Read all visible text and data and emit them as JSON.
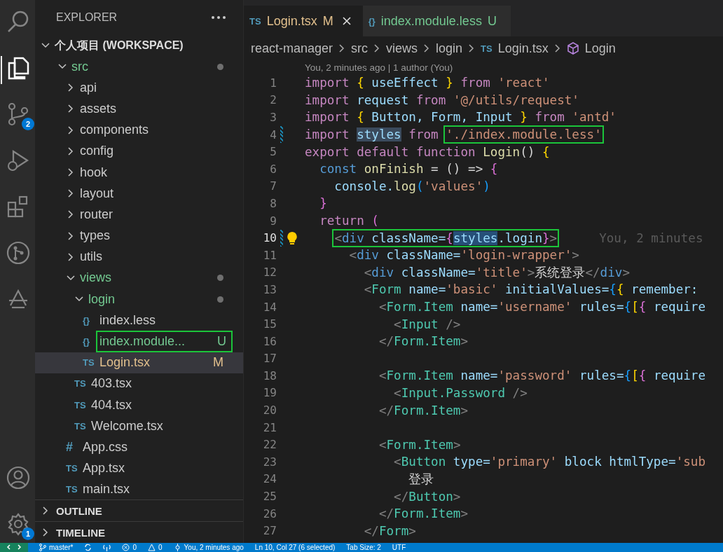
{
  "activity_bar": {
    "top": [
      {
        "kind": "search",
        "selected": false
      },
      {
        "kind": "explorer",
        "selected": true
      },
      {
        "kind": "source-control",
        "selected": false,
        "badge": "2"
      },
      {
        "kind": "run",
        "selected": false
      },
      {
        "kind": "extensions",
        "selected": false
      },
      {
        "kind": "git-graph",
        "selected": false
      },
      {
        "kind": "timeline",
        "selected": false
      }
    ],
    "bottom": [
      {
        "kind": "account"
      },
      {
        "kind": "settings",
        "badge": "1"
      }
    ]
  },
  "sidebar": {
    "title": "EXPLORER",
    "workspace": "个人项目 (WORKSPACE)",
    "tree": [
      {
        "name": "src",
        "kind": "folder",
        "expanded": true,
        "dot": true,
        "color": "#73c991",
        "children": [
          {
            "name": "api",
            "kind": "folder",
            "expanded": false,
            "color": "#cccccc"
          },
          {
            "name": "assets",
            "kind": "folder",
            "expanded": false,
            "color": "#cccccc"
          },
          {
            "name": "components",
            "kind": "folder",
            "expanded": false,
            "color": "#cccccc"
          },
          {
            "name": "config",
            "kind": "folder",
            "expanded": false,
            "color": "#cccccc"
          },
          {
            "name": "hook",
            "kind": "folder",
            "expanded": false,
            "color": "#cccccc"
          },
          {
            "name": "layout",
            "kind": "folder",
            "expanded": false,
            "color": "#cccccc"
          },
          {
            "name": "router",
            "kind": "folder",
            "expanded": false,
            "color": "#cccccc"
          },
          {
            "name": "types",
            "kind": "folder",
            "expanded": false,
            "color": "#cccccc"
          },
          {
            "name": "utils",
            "kind": "folder",
            "expanded": false,
            "color": "#cccccc"
          },
          {
            "name": "views",
            "kind": "folder",
            "expanded": true,
            "dot": true,
            "color": "#73c991",
            "children": [
              {
                "name": "login",
                "kind": "folder",
                "expanded": true,
                "dot": true,
                "color": "#73c991",
                "children": [
                  {
                    "name": "index.less",
                    "kind": "file",
                    "icon": "{}",
                    "selected": false,
                    "color": "#cccccc"
                  },
                  {
                    "name": "index.module...",
                    "kind": "file",
                    "icon": "{}",
                    "decoration": "U",
                    "highlighted": true,
                    "selected": false,
                    "color": "#73c991"
                  },
                  {
                    "name": "Login.tsx",
                    "kind": "file",
                    "icon": "TS",
                    "decoration": "M",
                    "selected": true,
                    "color": "#e2c08d"
                  }
                ]
              },
              {
                "name": "403.tsx",
                "kind": "file",
                "icon": "TS",
                "selected": false,
                "color": "#cccccc"
              },
              {
                "name": "404.tsx",
                "kind": "file",
                "icon": "TS",
                "selected": false,
                "color": "#cccccc"
              },
              {
                "name": "Welcome.tsx",
                "kind": "file",
                "icon": "TS",
                "selected": false,
                "color": "#cccccc"
              }
            ]
          },
          {
            "name": "App.css",
            "kind": "file",
            "icon": "#",
            "selected": false,
            "color": "#cccccc"
          },
          {
            "name": "App.tsx",
            "kind": "file",
            "icon": "TS",
            "selected": false,
            "color": "#cccccc"
          },
          {
            "name": "main.tsx",
            "kind": "file",
            "icon": "TS",
            "selected": false,
            "color": "#cccccc"
          }
        ]
      }
    ],
    "sections": [
      {
        "title": "OUTLINE",
        "expanded": false
      },
      {
        "title": "TIMELINE",
        "expanded": false
      }
    ]
  },
  "tabs": [
    {
      "icon": "TS",
      "label": "Login.tsx",
      "decoration": "M",
      "selected": true,
      "color": "#e2c08d"
    },
    {
      "icon": "{}",
      "label": "index.module.less",
      "decoration": "U",
      "selected": false,
      "color": "#73c991"
    }
  ],
  "breadcrumb": [
    {
      "label": "react-manager"
    },
    {
      "label": "src"
    },
    {
      "label": "views"
    },
    {
      "label": "login"
    },
    {
      "label": "Login.tsx",
      "icon": "TS"
    },
    {
      "label": "Login",
      "kind": "symbol"
    }
  ],
  "codelens": "You, 2 minutes ago | 1 author (You)",
  "code": [
    {
      "number": "1",
      "tokens": [
        {
          "t": "import ",
          "kind": "kw"
        },
        {
          "t": "{ ",
          "kind": "br"
        },
        {
          "t": "useEffect ",
          "kind": "var"
        },
        {
          "t": "} ",
          "kind": "br"
        },
        {
          "t": "from ",
          "kind": "kw"
        },
        {
          "t": "'react'",
          "kind": "str"
        }
      ]
    },
    {
      "number": "2",
      "tokens": [
        {
          "t": "import ",
          "kind": "kw"
        },
        {
          "t": "request ",
          "kind": "var"
        },
        {
          "t": "from ",
          "kind": "kw"
        },
        {
          "t": "'@/utils/request'",
          "kind": "str"
        }
      ]
    },
    {
      "number": "3",
      "tokens": [
        {
          "t": "import ",
          "kind": "kw"
        },
        {
          "t": "{ ",
          "kind": "br"
        },
        {
          "t": "Button, Form, Input ",
          "kind": "var"
        },
        {
          "t": "} ",
          "kind": "br"
        },
        {
          "t": "from ",
          "kind": "kw"
        },
        {
          "t": "'antd'",
          "kind": "str"
        }
      ]
    },
    {
      "number": "4",
      "modified": true,
      "tokens": [
        {
          "t": "import ",
          "kind": "kw"
        },
        {
          "t": "styles",
          "kind": "var",
          "selected": true
        },
        {
          "t": " from ",
          "kind": "kw"
        },
        {
          "kind": "frame",
          "tokens": [
            {
              "t": "'./index.module.less'",
              "kind": "str"
            }
          ]
        }
      ]
    },
    {
      "number": "5",
      "tokens": [
        {
          "t": "export default function ",
          "kind": "kw"
        },
        {
          "t": "Login",
          "kind": "fn"
        },
        {
          "t": "() ",
          "kind": "p"
        },
        {
          "t": "{",
          "kind": "br"
        }
      ]
    },
    {
      "number": "6",
      "tokens": [
        {
          "t": "  const",
          "kind": "kw2"
        },
        {
          "t": " onFinish ",
          "kind": "fn"
        },
        {
          "t": "= () => ",
          "kind": "p"
        },
        {
          "t": "{",
          "kind": "br2"
        }
      ]
    },
    {
      "number": "7",
      "tokens": [
        {
          "t": "    console.",
          "kind": "var"
        },
        {
          "t": "log",
          "kind": "fn"
        },
        {
          "t": "(",
          "kind": "br3"
        },
        {
          "t": "'values'",
          "kind": "str"
        },
        {
          "t": ")",
          "kind": "br3"
        }
      ]
    },
    {
      "number": "8",
      "tokens": [
        {
          "t": "  }",
          "kind": "br2"
        }
      ]
    },
    {
      "number": "9",
      "tokens": [
        {
          "t": "  return ",
          "kind": "kw"
        },
        {
          "t": "(",
          "kind": "br2"
        }
      ]
    },
    {
      "number": "10",
      "current": true,
      "modified": true,
      "lightbulb": true,
      "blame": "You, 2 minutes",
      "tokens": [
        {
          "kind": "frame",
          "tokens": [
            {
              "t": "    <",
              "kind": "ang"
            },
            {
              "t": "div",
              "kind": "tag"
            },
            {
              "t": " className=",
              "kind": "var"
            },
            {
              "t": "{",
              "kind": "br2"
            },
            {
              "t": "styles",
              "kind": "var",
              "selected": true
            },
            {
              "t": ".login",
              "kind": "var"
            },
            {
              "t": "}",
              "kind": "br2"
            },
            {
              "t": ">",
              "kind": "ang"
            }
          ]
        }
      ]
    },
    {
      "number": "11",
      "tokens": [
        {
          "t": "      <",
          "kind": "ang"
        },
        {
          "t": "div",
          "kind": "tag"
        },
        {
          "t": " className=",
          "kind": "var"
        },
        {
          "t": "'login-wrapper'",
          "kind": "str"
        },
        {
          "t": ">",
          "kind": "ang"
        }
      ]
    },
    {
      "number": "12",
      "tokens": [
        {
          "t": "        <",
          "kind": "ang"
        },
        {
          "t": "div",
          "kind": "tag"
        },
        {
          "t": " className=",
          "kind": "var"
        },
        {
          "t": "'title'",
          "kind": "str"
        },
        {
          "t": ">",
          "kind": "ang"
        },
        {
          "t": "系统登录",
          "kind": "p"
        },
        {
          "t": "</",
          "kind": "ang"
        },
        {
          "t": "div",
          "kind": "tag"
        },
        {
          "t": ">",
          "kind": "ang"
        }
      ]
    },
    {
      "number": "13",
      "tokens": [
        {
          "t": "        <",
          "kind": "ang"
        },
        {
          "t": "Form",
          "kind": "comp"
        },
        {
          "t": " name=",
          "kind": "var"
        },
        {
          "t": "'basic'",
          "kind": "str"
        },
        {
          "t": " initialValues=",
          "kind": "var"
        },
        {
          "t": "{",
          "kind": "br3"
        },
        {
          "t": "{",
          "kind": "br"
        },
        {
          "t": " remember:",
          "kind": "var"
        }
      ]
    },
    {
      "number": "14",
      "tokens": [
        {
          "t": "          <",
          "kind": "ang"
        },
        {
          "t": "Form.Item",
          "kind": "comp"
        },
        {
          "t": " name=",
          "kind": "var"
        },
        {
          "t": "'username'",
          "kind": "str"
        },
        {
          "t": " rules=",
          "kind": "var"
        },
        {
          "t": "{",
          "kind": "br3"
        },
        {
          "t": "[",
          "kind": "br"
        },
        {
          "t": "{",
          "kind": "br2"
        },
        {
          "t": " require",
          "kind": "var"
        }
      ]
    },
    {
      "number": "15",
      "tokens": [
        {
          "t": "            <",
          "kind": "ang"
        },
        {
          "t": "Input",
          "kind": "comp"
        },
        {
          "t": " />",
          "kind": "ang"
        }
      ]
    },
    {
      "number": "16",
      "tokens": [
        {
          "t": "          </",
          "kind": "ang"
        },
        {
          "t": "Form.Item",
          "kind": "comp"
        },
        {
          "t": ">",
          "kind": "ang"
        }
      ]
    },
    {
      "number": "17"
    },
    {
      "number": "18",
      "tokens": [
        {
          "t": "          <",
          "kind": "ang"
        },
        {
          "t": "Form.Item",
          "kind": "comp"
        },
        {
          "t": " name=",
          "kind": "var"
        },
        {
          "t": "'password'",
          "kind": "str"
        },
        {
          "t": " rules=",
          "kind": "var"
        },
        {
          "t": "{",
          "kind": "br3"
        },
        {
          "t": "[",
          "kind": "br"
        },
        {
          "t": "{",
          "kind": "br2"
        },
        {
          "t": " require",
          "kind": "var"
        }
      ]
    },
    {
      "number": "19",
      "tokens": [
        {
          "t": "            <",
          "kind": "ang"
        },
        {
          "t": "Input.Password",
          "kind": "comp"
        },
        {
          "t": " />",
          "kind": "ang"
        }
      ]
    },
    {
      "number": "20",
      "tokens": [
        {
          "t": "          </",
          "kind": "ang"
        },
        {
          "t": "Form.Item",
          "kind": "comp"
        },
        {
          "t": ">",
          "kind": "ang"
        }
      ]
    },
    {
      "number": "21"
    },
    {
      "number": "22",
      "tokens": [
        {
          "t": "          <",
          "kind": "ang"
        },
        {
          "t": "Form.Item",
          "kind": "comp"
        },
        {
          "t": ">",
          "kind": "ang"
        }
      ]
    },
    {
      "number": "23",
      "tokens": [
        {
          "t": "            <",
          "kind": "ang"
        },
        {
          "t": "Button",
          "kind": "comp"
        },
        {
          "t": " type=",
          "kind": "var"
        },
        {
          "t": "'primary'",
          "kind": "str"
        },
        {
          "t": " block htmlType=",
          "kind": "var"
        },
        {
          "t": "'sub",
          "kind": "str"
        }
      ]
    },
    {
      "number": "24",
      "tokens": [
        {
          "t": "              登录",
          "kind": "p"
        }
      ]
    },
    {
      "number": "25",
      "tokens": [
        {
          "t": "            </",
          "kind": "ang"
        },
        {
          "t": "Button",
          "kind": "comp"
        },
        {
          "t": ">",
          "kind": "ang"
        }
      ]
    },
    {
      "number": "26",
      "tokens": [
        {
          "t": "          </",
          "kind": "ang"
        },
        {
          "t": "Form.Item",
          "kind": "comp"
        },
        {
          "t": ">",
          "kind": "ang"
        }
      ]
    },
    {
      "number": "27",
      "tokens": [
        {
          "t": "        </",
          "kind": "ang"
        },
        {
          "t": "Form",
          "kind": "comp"
        },
        {
          "t": ">",
          "kind": "ang"
        }
      ]
    }
  ],
  "status_bar": [
    {
      "kind": "branch",
      "text": "master*"
    },
    {
      "kind": "sync"
    },
    {
      "kind": "ports"
    },
    {
      "kind": "errors",
      "text": "0"
    },
    {
      "kind": "warnings",
      "text": "0"
    },
    {
      "kind": "blame",
      "text": "You, 2 minutes ago"
    },
    {
      "kind": "plain",
      "text": "Ln 10, Col 27 (6 selected)"
    },
    {
      "kind": "plain",
      "text": "Tab Size: 2"
    },
    {
      "kind": "plain",
      "text": "UTF"
    }
  ]
}
